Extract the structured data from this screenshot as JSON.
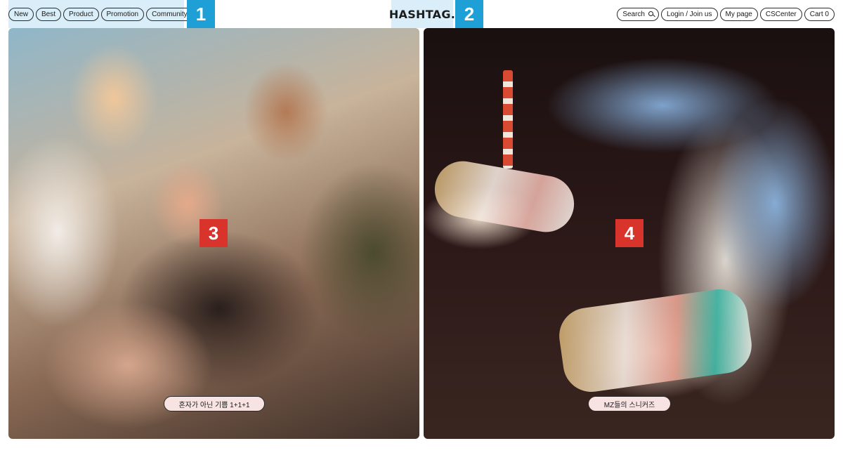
{
  "header": {
    "nav_left": [
      "New",
      "Best",
      "Product",
      "Promotion",
      "Community"
    ],
    "logo": "HASHTAG.",
    "nav_right": {
      "search": "Search",
      "login": "Login / Join us",
      "mypage": "My page",
      "cscenter": "CSCenter",
      "cart": "Cart 0"
    },
    "markers": [
      "1",
      "2"
    ]
  },
  "banners": [
    {
      "marker": "3",
      "caption": "혼자가 아닌 기쁨 1+1+1"
    },
    {
      "marker": "4",
      "caption": "MZ들의 스니커즈"
    }
  ],
  "colors": {
    "highlight_blue": "#d9eef8",
    "marker_blue": "#1e9fd6",
    "marker_red": "#d8342b",
    "caption_bg": "#f7e4e2"
  }
}
